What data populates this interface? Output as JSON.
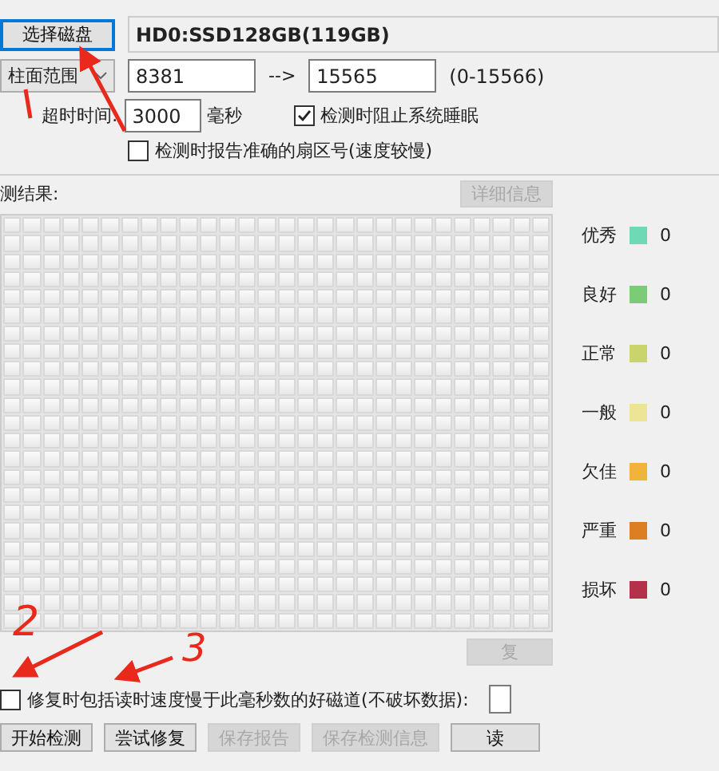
{
  "disk": {
    "button": "选择磁盘",
    "name": "HD0:SSD128GB(119GB)"
  },
  "range": {
    "mode": "柱面范围",
    "start": "8381",
    "arrow": "-->",
    "end": "15565",
    "limits": "(0-15566)"
  },
  "timeout": {
    "label": "超时时间:",
    "value": "3000",
    "unit": "毫秒"
  },
  "options": [
    {
      "label": "检测时阻止系统睡眠",
      "checked": true
    },
    {
      "label": "检测时报告准确的扇区号(速度较慢)",
      "checked": false
    }
  ],
  "results": {
    "label": "测结果:",
    "details_button": {
      "label": "详细信息",
      "disabled": true
    }
  },
  "legend": [
    {
      "label": "优秀",
      "color": "#6fd8b4",
      "count": "0"
    },
    {
      "label": "良好",
      "color": "#7bcb78",
      "count": "0"
    },
    {
      "label": "正常",
      "color": "#c9d46a",
      "count": "0"
    },
    {
      "label": "一般",
      "color": "#ece497",
      "count": "0"
    },
    {
      "label": "欠佳",
      "color": "#f0b43a",
      "count": "0"
    },
    {
      "label": "严重",
      "color": "#db7f22",
      "count": "0"
    },
    {
      "label": "损坏",
      "color": "#b5304a",
      "count": "0"
    }
  ],
  "reset_button": {
    "label": "复",
    "disabled": true
  },
  "repair_option": {
    "label": "修复时包括读时速度慢于此毫秒数的好磁道(不破坏数据):",
    "checked": false
  },
  "buttons": [
    {
      "label": "开始检测",
      "disabled": false
    },
    {
      "label": "尝试修复",
      "disabled": false
    },
    {
      "label": "保存报告",
      "disabled": true
    },
    {
      "label": "保存检测信息",
      "disabled": true
    },
    {
      "label": "读",
      "disabled": false
    }
  ],
  "annotations": [
    {
      "label": "2"
    },
    {
      "label": "3"
    }
  ]
}
